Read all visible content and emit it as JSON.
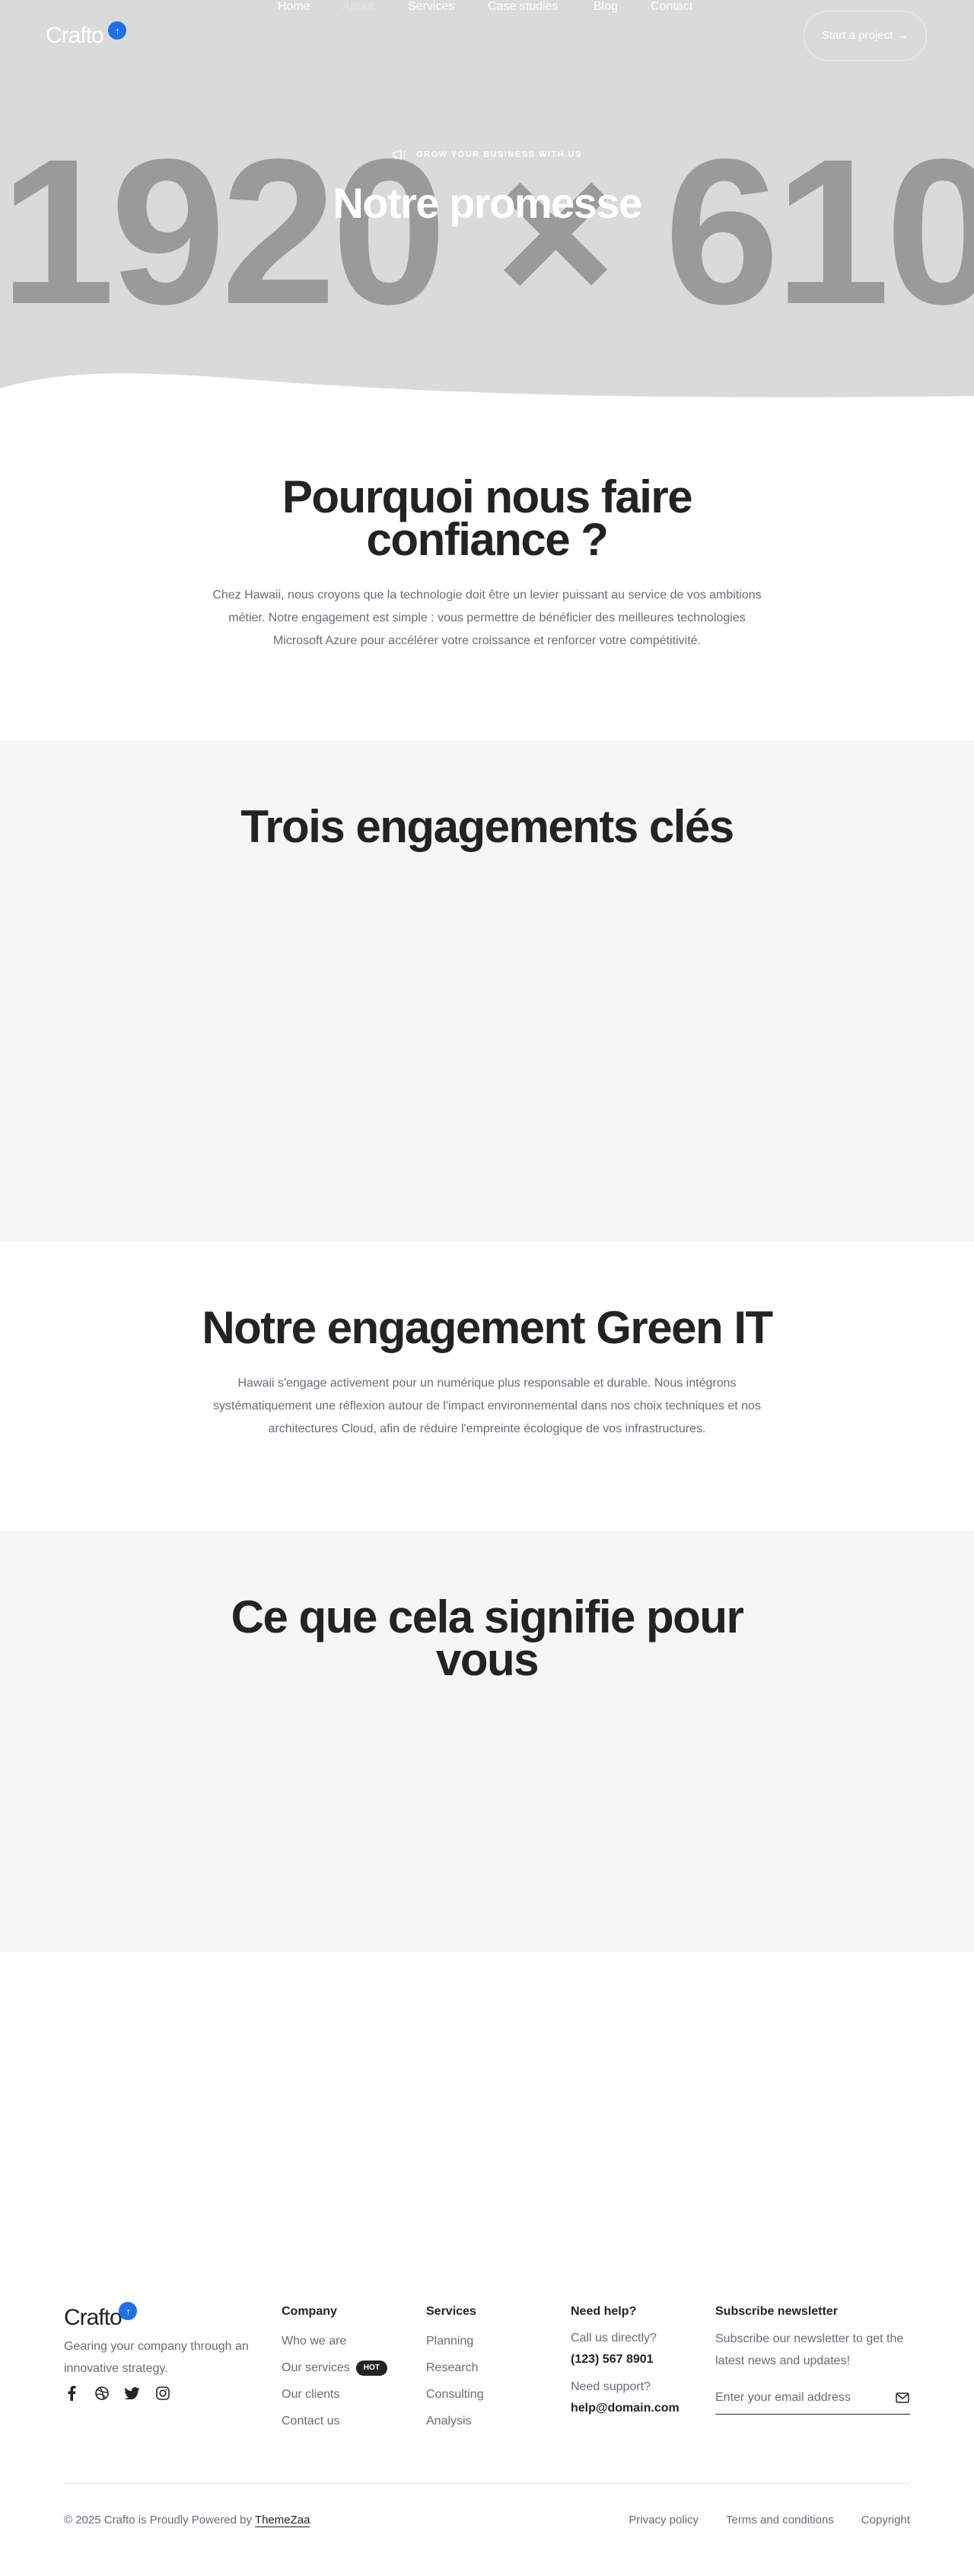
{
  "hero": {
    "placeholder": "1920 × 610",
    "eyebrow": "GROW YOUR BUSINESS WITH US",
    "title": "Notre promesse",
    "eyebrow_icon": "megaphone-icon"
  },
  "nav": {
    "logo": "Crafto",
    "items": [
      {
        "label": "Home"
      },
      {
        "label": "About"
      },
      {
        "label": "Services"
      },
      {
        "label": "Case studies"
      },
      {
        "label": "Blog"
      },
      {
        "label": "Contact"
      }
    ],
    "cta": "Start a project"
  },
  "sections": {
    "why": {
      "title": "Pourquoi nous faire confiance ?",
      "text": "Chez Hawaii, nous croyons que la technologie doit être un levier puissant au service de vos ambitions métier. Notre engagement est simple : vous permettre de bénéficier des meilleures technologies Microsoft Azure pour accélérer votre croissance et renforcer votre compétitivité."
    },
    "commitments": {
      "title": "Trois engagements clés"
    },
    "green": {
      "title": "Notre engagement Green IT",
      "text": "Hawaii s'engage activement pour un numérique plus responsable et durable. Nous intégrons systématiquement une réflexion autour de l'impact environnemental dans nos choix techniques et nos architectures Cloud, afin de réduire l'empreinte écologique de vos infrastructures."
    },
    "meaning": {
      "title": "Ce que cela signifie pour vous"
    }
  },
  "footer": {
    "logo": "Crafto",
    "tagline": "Gearing your company through an innovative strategy.",
    "social": [
      "facebook-icon",
      "dribbble-icon",
      "twitter-icon",
      "instagram-icon"
    ],
    "company": {
      "heading": "Company",
      "links": [
        "Who we are",
        "Our services",
        "Our clients",
        "Contact us"
      ],
      "badge": "HOT"
    },
    "services": {
      "heading": "Services",
      "links": [
        "Planning",
        "Research",
        "Consulting",
        "Analysis"
      ]
    },
    "help": {
      "heading": "Need help?",
      "call_label": "Call us directly?",
      "phone": "(123) 567 8901",
      "support_label": "Need support?",
      "email": "help@domain.com"
    },
    "newsletter": {
      "heading": "Subscribe newsletter",
      "text": "Subscribe our newsletter to get the latest news and updates!",
      "placeholder": "Enter your email address"
    },
    "copyright_prefix": "© 2025 Crafto is Proudly Powered by",
    "copyright_link": "ThemeZaa",
    "legal": [
      "Privacy policy",
      "Terms and conditions",
      "Copyright"
    ]
  },
  "colors": {
    "accent": "#1f6fe8",
    "dark": "#232323",
    "muted": "#6a6b7a",
    "hero_bg": "#dadada",
    "alt_bg": "#f6f6f6"
  }
}
